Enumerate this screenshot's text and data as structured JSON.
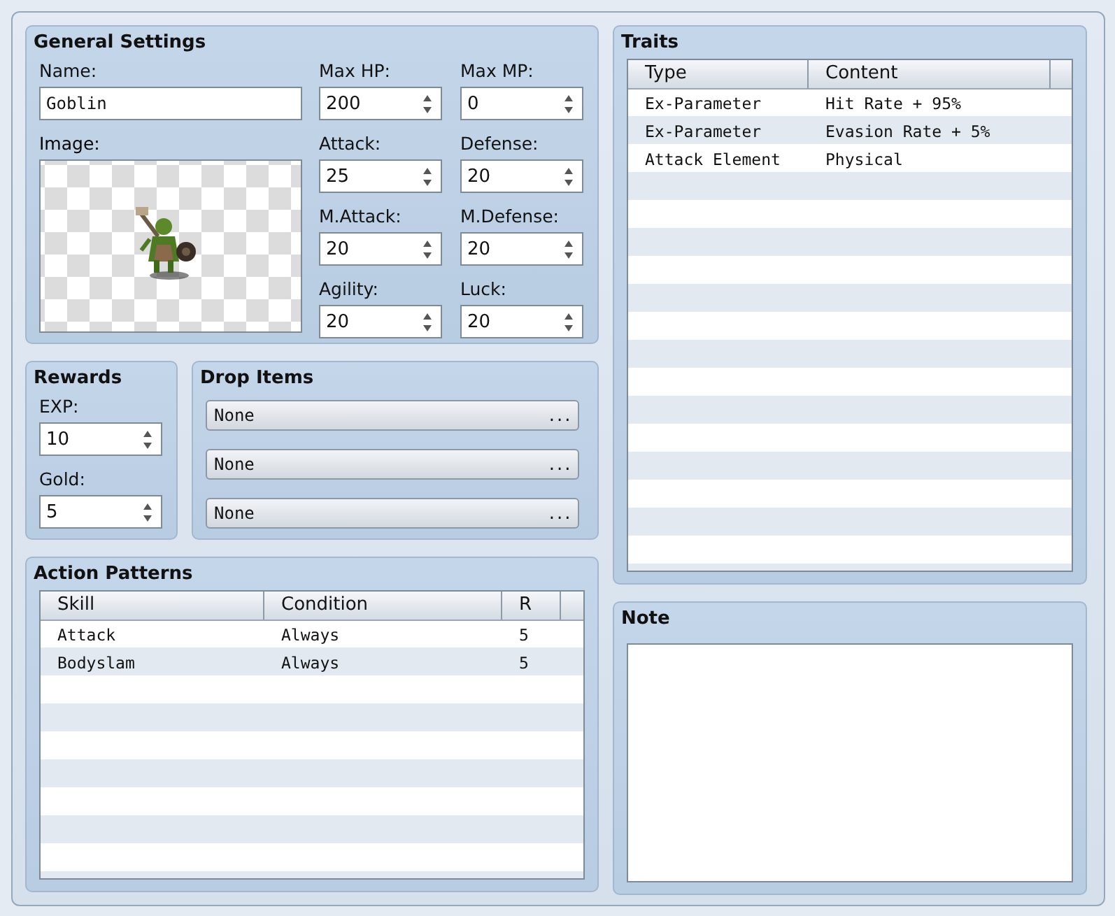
{
  "general_settings": {
    "title": "General Settings",
    "name": {
      "label": "Name:",
      "value": "Goblin"
    },
    "image": {
      "label": "Image:",
      "kind": "picture"
    },
    "stats": [
      {
        "label": "Max HP:",
        "value": "200"
      },
      {
        "label": "Max MP:",
        "value": "0"
      },
      {
        "label": "Attack:",
        "value": "25"
      },
      {
        "label": "Defense:",
        "value": "20"
      },
      {
        "label": "M.Attack:",
        "value": "20"
      },
      {
        "label": "M.Defense:",
        "value": "20"
      },
      {
        "label": "Agility:",
        "value": "20"
      },
      {
        "label": "Luck:",
        "value": "20"
      }
    ]
  },
  "rewards": {
    "title": "Rewards",
    "fields": [
      {
        "label": "EXP:",
        "value": "10"
      },
      {
        "label": "Gold:",
        "value": "5"
      }
    ]
  },
  "drop_items": {
    "title": "Drop Items",
    "items": [
      {
        "value": "None",
        "button": "..."
      },
      {
        "value": "None",
        "button": "..."
      },
      {
        "value": "None",
        "button": "..."
      }
    ]
  },
  "action_patterns": {
    "title": "Action Patterns",
    "columns": [
      "Skill",
      "Condition",
      "R"
    ],
    "rows": [
      [
        "Attack",
        "Always",
        "5"
      ],
      [
        "Bodyslam",
        "Always",
        "5"
      ]
    ]
  },
  "traits": {
    "title": "Traits",
    "columns": [
      "Type",
      "Content"
    ],
    "rows": [
      [
        "Ex-Parameter",
        "Hit Rate + 95%"
      ],
      [
        "Ex-Parameter",
        "Evasion Rate + 5%"
      ],
      [
        "Attack Element",
        "Physical"
      ]
    ]
  },
  "note": {
    "title": "Note"
  }
}
